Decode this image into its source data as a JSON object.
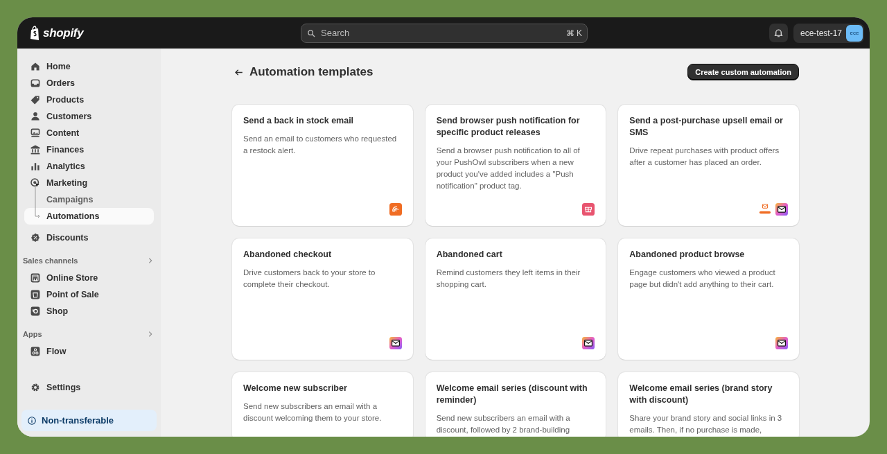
{
  "topbar": {
    "logo": "shopify",
    "search": {
      "placeholder": "Search",
      "shortcut": "⌘ K"
    },
    "store": "ece-test-17",
    "avatar": "ece"
  },
  "sidebar": {
    "items": [
      {
        "label": "Home",
        "selected": false
      },
      {
        "label": "Orders",
        "selected": false
      },
      {
        "label": "Products",
        "selected": false
      },
      {
        "label": "Customers",
        "selected": false
      },
      {
        "label": "Content",
        "selected": false
      },
      {
        "label": "Finances",
        "selected": false
      },
      {
        "label": "Analytics",
        "selected": false
      },
      {
        "label": "Marketing",
        "selected": false,
        "children": [
          {
            "label": "Campaigns",
            "selected": false
          },
          {
            "label": "Automations",
            "selected": true
          }
        ]
      },
      {
        "label": "Discounts",
        "selected": false
      }
    ],
    "sections": [
      {
        "title": "Sales channels",
        "items": [
          {
            "label": "Online Store"
          },
          {
            "label": "Point of Sale"
          },
          {
            "label": "Shop"
          }
        ]
      },
      {
        "title": "Apps",
        "items": [
          {
            "label": "Flow"
          }
        ]
      }
    ],
    "settings": "Settings",
    "notice": "Non-transferable"
  },
  "page": {
    "title": "Automation templates",
    "action": "Create custom automation"
  },
  "templates": [
    {
      "title": "Send a back in stock email",
      "description": "Send an email to customers who requested a restock alert.",
      "apps": [
        {
          "kind": "orange"
        }
      ]
    },
    {
      "title": "Send browser push notification for specific product releases",
      "description": "Send a browser push notification to all of your PushOwl subscribers when a new product you've added includes a \"Push notification\" product tag.",
      "apps": [
        {
          "kind": "pink"
        }
      ]
    },
    {
      "title": "Send a post-purchase upsell email or SMS",
      "description": "Drive repeat purchases with product offers after a customer has placed an order.",
      "apps": [
        {
          "kind": "aftership"
        },
        {
          "kind": "email"
        }
      ]
    },
    {
      "title": "Abandoned checkout",
      "description": "Drive customers back to your store to complete their checkout.",
      "apps": [
        {
          "kind": "email"
        }
      ]
    },
    {
      "title": "Abandoned cart",
      "description": "Remind customers they left items in their shopping cart.",
      "apps": [
        {
          "kind": "email"
        }
      ]
    },
    {
      "title": "Abandoned product browse",
      "description": "Engage customers who viewed a product page but didn't add anything to their cart.",
      "apps": [
        {
          "kind": "email"
        }
      ]
    },
    {
      "title": "Welcome new subscriber",
      "description": "Send new subscribers an email with a discount welcoming them to your store."
    },
    {
      "title": "Welcome email series (discount with reminder)",
      "description": "Send new subscribers an email with a discount, followed by 2 brand-building"
    },
    {
      "title": "Welcome email series (brand story with discount)",
      "description": "Share your brand story and social links in 3 emails. Then, if no purchase is made,"
    }
  ]
}
